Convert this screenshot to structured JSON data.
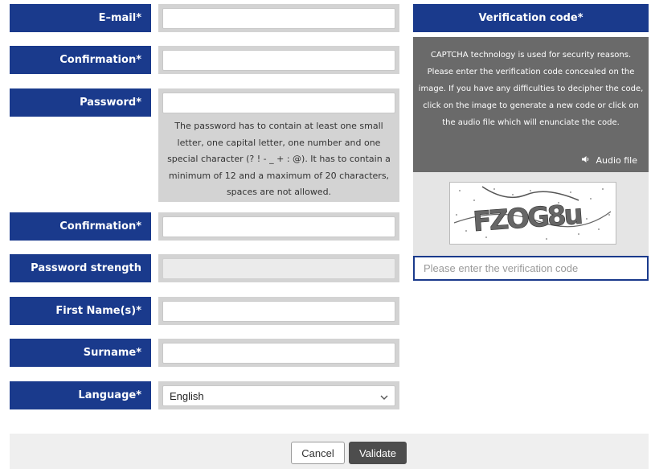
{
  "form": {
    "email_label": "E–mail*",
    "confirmation1_label": "Confirmation*",
    "password_label": "Password*",
    "password_hint": "The password has to contain at least one small letter, one capital letter, one number and one special character (? ! - _ + : @). It has to contain a minimum of 12 and a maximum of 20 characters, spaces are not allowed.",
    "confirmation2_label": "Confirmation*",
    "strength_label": "Password strength",
    "firstname_label": "First Name(s)*",
    "surname_label": "Surname*",
    "language_label": "Language*",
    "language_value": "English",
    "email_value": "",
    "confirmation1_value": "",
    "password_value": "",
    "confirmation2_value": "",
    "firstname_value": "",
    "surname_value": ""
  },
  "verification": {
    "header": "Verification code*",
    "description": "CAPTCHA technology is used for security reasons. Please enter the verification code concealed on the image. If you have any difficulties to decipher the code, click on the image to generate a new code or click on the audio file which will enunciate the code.",
    "audio_label": "Audio file",
    "captcha_text": "FZOG8u",
    "input_placeholder": "Please enter the verification code"
  },
  "footer": {
    "cancel_label": "Cancel",
    "validate_label": "Validate"
  },
  "colors": {
    "label_bg": "#1a3a8c",
    "field_wrap_bg": "#d3d3d3",
    "captcha_panel_bg": "#6a6a6a",
    "validate_bg": "#4d4d4d"
  },
  "icons": {
    "audio": "speaker-icon",
    "select": "chevron-down-icon"
  }
}
